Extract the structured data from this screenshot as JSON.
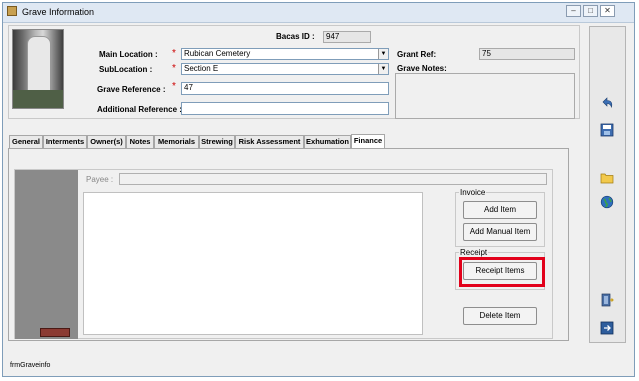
{
  "window": {
    "title": "Grave Information",
    "minimize": "–",
    "maximize": "□",
    "close": "✕"
  },
  "header": {
    "bacas_id_label": "Bacas ID :",
    "bacas_id_value": "947",
    "main_location_label": "Main Location :",
    "main_location_value": "Rubican Cemetery",
    "sublocation_label": "SubLocation :",
    "sublocation_value": "Section E",
    "grave_reference_label": "Grave Reference :",
    "grave_reference_value": "47",
    "additional_reference_label": "Additional Reference :",
    "additional_reference_value": "",
    "grant_ref_label": "Grant Ref:",
    "grant_ref_value": "75",
    "grave_notes_label": "Grave Notes:",
    "required_marker": "*"
  },
  "tabs": [
    {
      "label": "General"
    },
    {
      "label": "Interments"
    },
    {
      "label": "Owner(s)"
    },
    {
      "label": "Notes"
    },
    {
      "label": "Memorials"
    },
    {
      "label": "Strewing"
    },
    {
      "label": "Risk Assessment"
    },
    {
      "label": "Exhumation"
    },
    {
      "label": "Finance"
    }
  ],
  "active_tab": "Finance",
  "finance": {
    "payee_label": "Payee :",
    "invoice_group_label": "Invoice",
    "add_item": "Add Item",
    "add_manual_item": "Add Manual Item",
    "receipt_group_label": "Receipt",
    "receipt_items": "Receipt Items",
    "delete_item": "Delete  Item"
  },
  "toolbar_icons": [
    "undo-icon",
    "save-icon",
    "folder-icon",
    "globe-icon",
    "export-icon",
    "exit-icon"
  ],
  "status_bar": {
    "form_name": "frmGraveinfo"
  },
  "colors": {
    "highlight": "#e2001a",
    "required": "#cc0000"
  }
}
